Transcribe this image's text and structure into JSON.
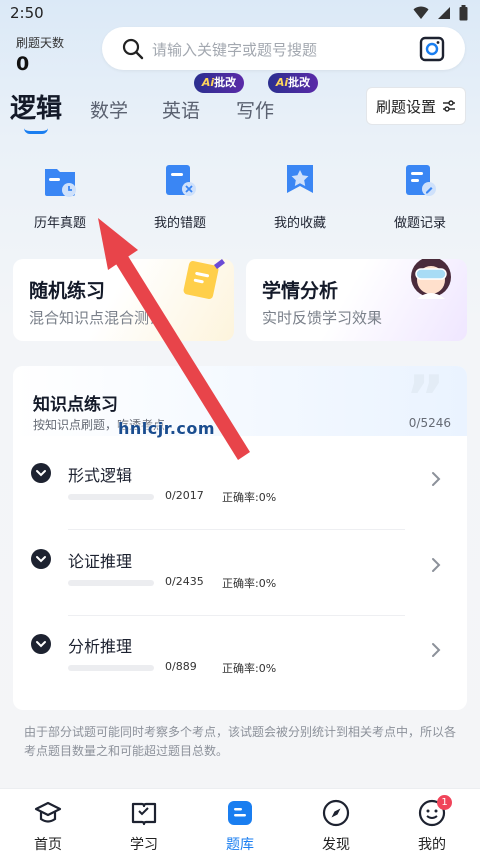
{
  "status": {
    "time": "2:50"
  },
  "days": {
    "label": "刷题天数",
    "value": "0"
  },
  "search": {
    "placeholder": "请输入关键字或题号搜题"
  },
  "tabs": [
    {
      "label": "逻辑",
      "active": true
    },
    {
      "label": "数学"
    },
    {
      "label": "英语",
      "badge": "批改"
    },
    {
      "label": "写作",
      "badge": "批改"
    }
  ],
  "ai_badge_prefix": "Ai",
  "settings": {
    "label": "刷题设置"
  },
  "quick": [
    {
      "label": "历年真题",
      "icon": "calendar-file-icon"
    },
    {
      "label": "我的错题",
      "icon": "wrong-file-icon"
    },
    {
      "label": "我的收藏",
      "icon": "star-bookmark-icon"
    },
    {
      "label": "做题记录",
      "icon": "record-pen-icon"
    }
  ],
  "cards": [
    {
      "title": "随机练习",
      "subtitle": "混合知识点混合测试"
    },
    {
      "title": "学情分析",
      "subtitle": "实时反馈学习效果"
    }
  ],
  "knowledge": {
    "title": "知识点练习",
    "subtitle": "按知识点刷题，吃透考点",
    "total": "0/5246",
    "items": [
      {
        "name": "形式逻辑",
        "count": "0/2017",
        "accuracy": "正确率:0%",
        "progress": 0
      },
      {
        "name": "论证推理",
        "count": "0/2435",
        "accuracy": "正确率:0%",
        "progress": 0
      },
      {
        "name": "分析推理",
        "count": "0/889",
        "accuracy": "正确率:0%",
        "progress": 0
      }
    ]
  },
  "note": "由于部分试题可能同时考察多个考点，该试题会被分别统计到相关考点中，所以各考点题目数量之和可能超过题目总数。",
  "nav": [
    {
      "label": "首页",
      "icon": "graduation-cap-icon"
    },
    {
      "label": "学习",
      "icon": "book-icon"
    },
    {
      "label": "题库",
      "icon": "question-bank-icon",
      "active": true
    },
    {
      "label": "发现",
      "icon": "compass-icon"
    },
    {
      "label": "我的",
      "icon": "profile-face-icon",
      "badge": "1"
    }
  ],
  "watermark": "hnlcjr.com",
  "colors": {
    "accent": "#1a7ef0",
    "badge": "#f0445a",
    "arrow": "#e8444a"
  }
}
